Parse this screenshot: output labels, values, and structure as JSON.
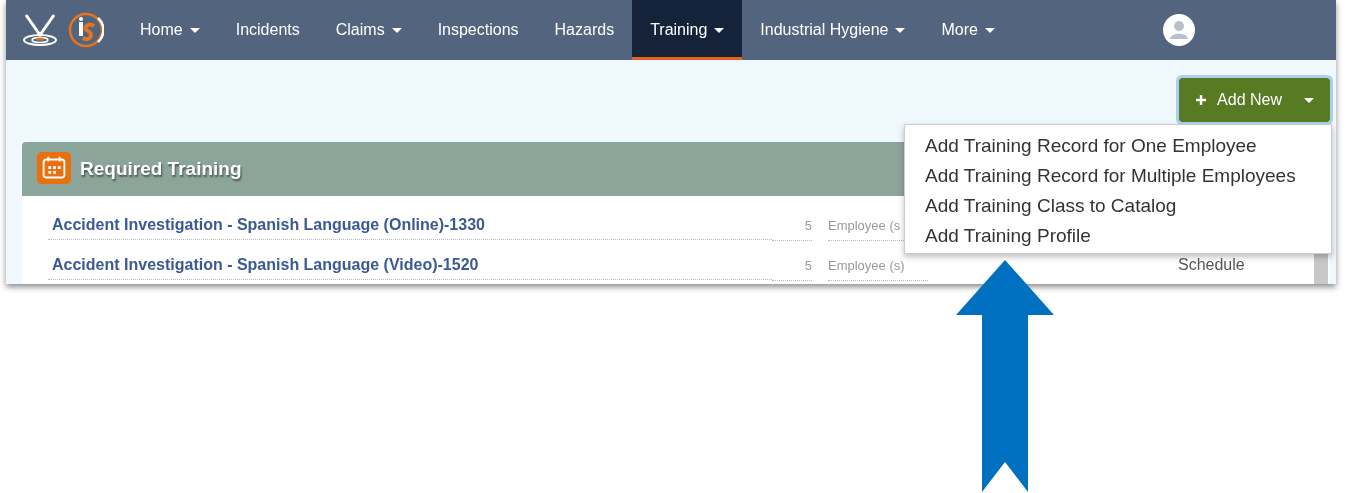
{
  "nav": {
    "items": [
      {
        "label": "Home",
        "dropdown": true,
        "selected": false
      },
      {
        "label": "Incidents",
        "dropdown": false,
        "selected": false
      },
      {
        "label": "Claims",
        "dropdown": true,
        "selected": false
      },
      {
        "label": "Inspections",
        "dropdown": false,
        "selected": false
      },
      {
        "label": "Hazards",
        "dropdown": false,
        "selected": false
      },
      {
        "label": "Training",
        "dropdown": true,
        "selected": true
      },
      {
        "label": "Industrial Hygiene",
        "dropdown": true,
        "selected": false
      },
      {
        "label": "More",
        "dropdown": true,
        "selected": false
      }
    ]
  },
  "add_new": {
    "label": "Add New",
    "menu": [
      "Add Training Record for One Employee",
      "Add Training Record for Multiple Employees",
      "Add Training Class to Catalog",
      "Add Training Profile"
    ]
  },
  "panel": {
    "title": "Required Training",
    "rows": [
      {
        "title": "Accident Investigation - Spanish Language (Online)-1330",
        "count": "5",
        "assignee": "Employee (s",
        "action": ""
      },
      {
        "title": "Accident Investigation - Spanish Language (Video)-1520",
        "count": "5",
        "assignee": "Employee (s)",
        "action": "Schedule"
      }
    ]
  }
}
